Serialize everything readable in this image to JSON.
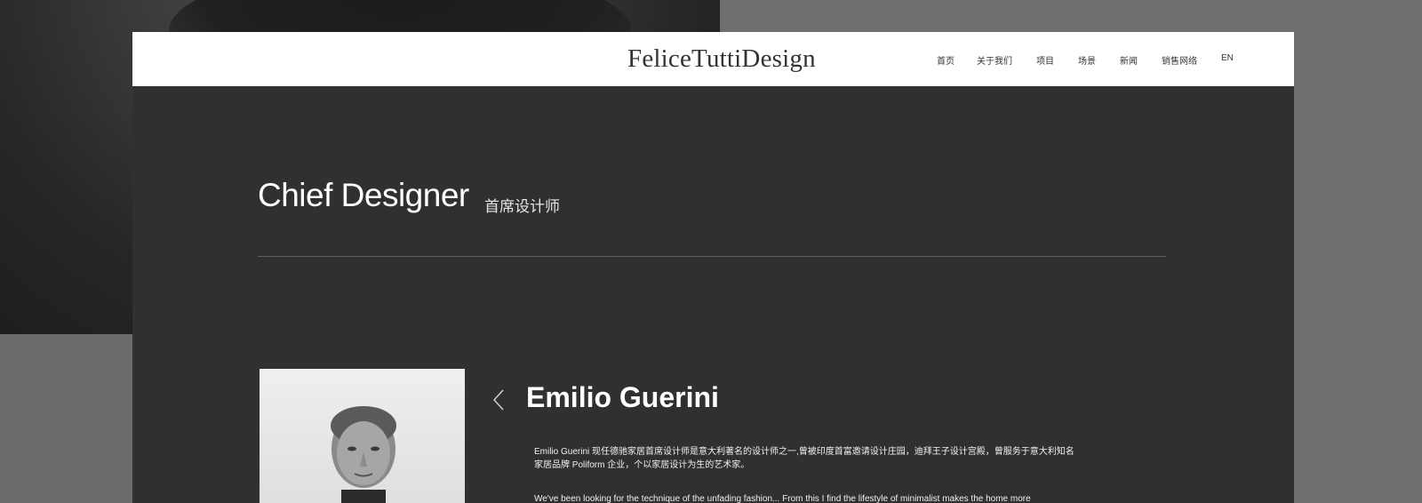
{
  "brand": {
    "logo_text": "FeliceTuttiDesign"
  },
  "nav": {
    "items": [
      {
        "label": "首页"
      },
      {
        "label": "关于我们"
      },
      {
        "label": "项目"
      },
      {
        "label": "场景"
      },
      {
        "label": "新闻"
      },
      {
        "label": "销售网络"
      },
      {
        "label": "EN"
      }
    ]
  },
  "section": {
    "title": "Chief Designer",
    "subtitle": "首席设计师"
  },
  "designer": {
    "name": "Emilio Guerini",
    "bio_cn_line1": "Emilio Guerini 现任德驰家居首席设计师是意大利著名的设计师之一,曾被印度首富邀请设计庄园，迪拜王子设计宫殿，曾服务于意大利知名",
    "bio_cn_line2": "家居品牌 Poliform 企业，个以家居设计为生的艺术家。",
    "bio_en": "We've been looking for the technique of the unfading fashion... From this I find the lifestyle of minimalist  makes the home more"
  },
  "icons": {
    "prev": "chevron-left-icon",
    "portrait": "portrait-photo"
  },
  "colors": {
    "page_bg": "#6b6b6b",
    "panel_bg": "#303030",
    "header_bg": "#ffffff",
    "text_light": "#ffffff"
  }
}
